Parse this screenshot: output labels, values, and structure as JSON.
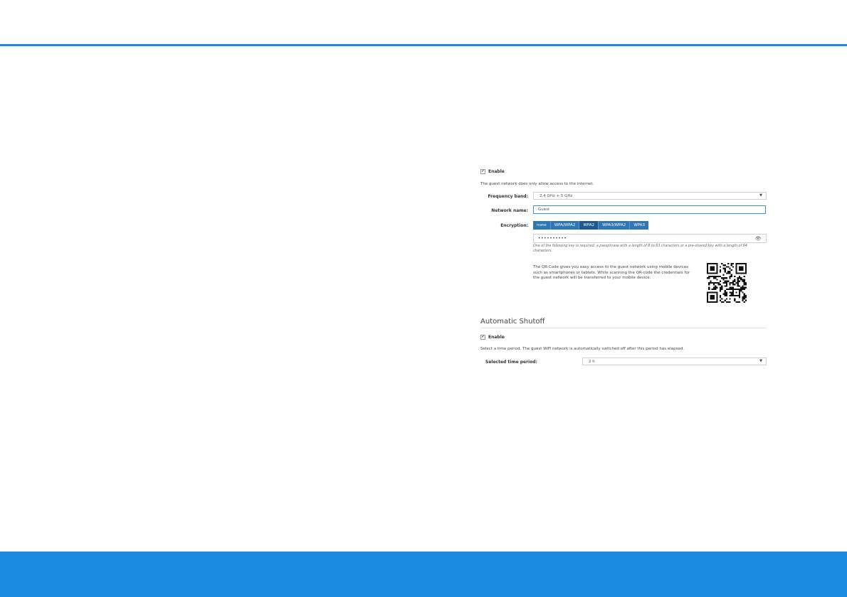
{
  "colors": {
    "accent": "#1a8be0",
    "button": "#2f76b5",
    "button_active": "#1e5a90"
  },
  "guest": {
    "enable_label": "Enable",
    "note": "The guest network does only allow access to the internet.",
    "frequency_label": "Frequency band:",
    "frequency_value": "2.4 GHz + 5 GHz",
    "name_label": "Network name:",
    "name_value": "Guest",
    "encryption_label": "Encryption:",
    "encryption_options": [
      "none",
      "WPA/WPA2",
      "WPA2",
      "WPA3/WPA2",
      "WPA3"
    ],
    "encryption_selected": "WPA2",
    "password_mask": "••••••••••",
    "key_hint": "One of the following key is required: a passphrase with a length of 8 to 63 characters or a pre-shared key with a length of 64 characters.",
    "qr_text": "The QR-Code gives you easy access to the guest network using mobile devices such as smartphones or tablets. While scanning the QR-code the credentials for the guest network will be transferred to your mobile device."
  },
  "shutoff": {
    "heading": "Automatic Shutoff",
    "enable_label": "Enable",
    "note": "Select a time period. The guest WiFi network is automatically switched off after this period has elapsed.",
    "period_label": "Selected time period:",
    "period_value": "2 h"
  },
  "icons": {
    "checkbox": "checkmark-icon",
    "eye": "eye-icon",
    "caret": "caret-down-icon",
    "qr": "qr-code-icon"
  }
}
